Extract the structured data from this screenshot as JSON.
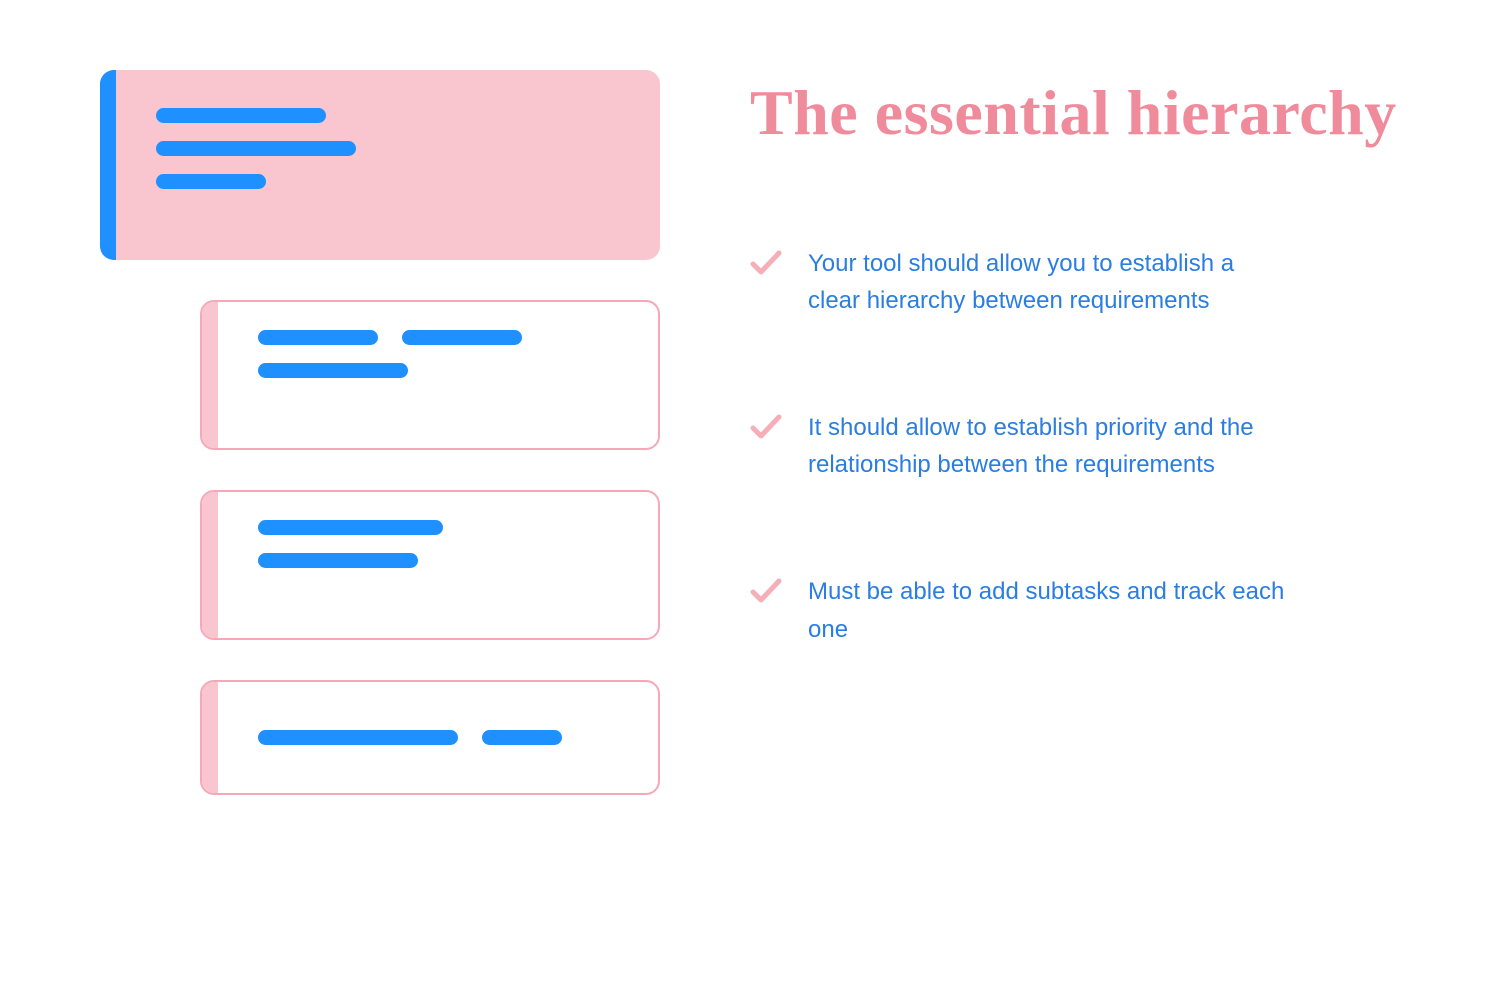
{
  "heading": "The essential hierarchy",
  "bullets": [
    "Your tool should allow you to establish a clear hierarchy between requirements",
    "It should allow to establish priority and the relationship between the requirements",
    "Must be able to add subtasks and track each one"
  ],
  "colors": {
    "pink_light": "#f9c6d0",
    "pink_heading": "#f08b9c",
    "blue": "#1e90ff",
    "blue_text": "#2a7de1"
  }
}
